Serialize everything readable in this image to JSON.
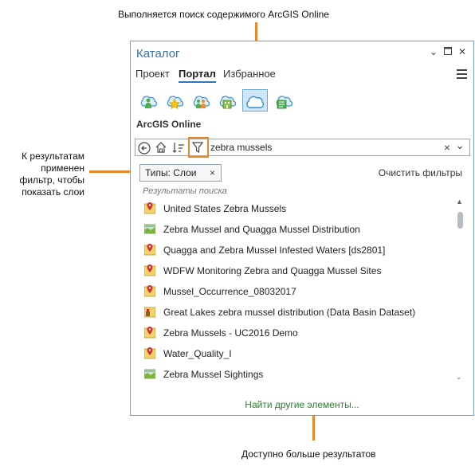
{
  "callouts": {
    "top": "Выполняется поиск содержимого ArcGIS Online",
    "left": [
      "К результатам",
      "применен",
      "фильтр, чтобы",
      "показать слои"
    ],
    "bottom": "Доступно больше результатов"
  },
  "panel": {
    "title": "Каталог",
    "tabs": [
      {
        "label": "Проект",
        "active": false
      },
      {
        "label": "Портал",
        "active": true
      },
      {
        "label": "Избранное",
        "active": false
      }
    ],
    "source_icons": [
      "my-content-icon",
      "favorites-icon",
      "groups-icon",
      "organization-icon",
      "arcgis-online-icon",
      "living-atlas-icon"
    ],
    "selected_source": "arcgis-online-icon",
    "source_label": "ArcGIS Online",
    "search": {
      "value": "zebra mussels",
      "clear": "×",
      "dropdown": "⌄"
    },
    "filter_chip": {
      "label": "Типы: Слои",
      "remove": "×"
    },
    "clear_filters": "Очистить фильтры",
    "results_header": "Результаты поиска",
    "results": [
      {
        "label": "United States Zebra Mussels",
        "icon": "feature-layer-icon"
      },
      {
        "label": "Zebra Mussel and Quagga Mussel Distribution",
        "icon": "map-image-layer-icon"
      },
      {
        "label": "Quagga and Zebra Mussel Infested Waters [ds2801]",
        "icon": "feature-layer-icon"
      },
      {
        "label": "WDFW Monitoring Zebra and Quagga Mussel Sites",
        "icon": "feature-layer-icon"
      },
      {
        "label": "Mussel_Occurrence_08032017",
        "icon": "feature-layer-icon"
      },
      {
        "label": "Great Lakes zebra mussel distribution (Data Basin Dataset)",
        "icon": "data-basin-layer-icon"
      },
      {
        "label": "Zebra Mussels - UC2016 Demo",
        "icon": "feature-layer-icon"
      },
      {
        "label": "Water_Quality_I",
        "icon": "feature-layer-icon"
      },
      {
        "label": "Zebra Mussel Sightings",
        "icon": "map-image-layer-icon"
      }
    ],
    "find_more": "Найти другие элементы..."
  },
  "colors": {
    "accent": "#3172b9",
    "callout_line": "#e8882b",
    "link_green": "#2e7d32",
    "panel_border": "#7aa0c8"
  }
}
